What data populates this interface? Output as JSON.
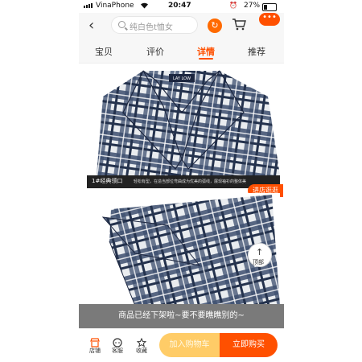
{
  "status_bar": {
    "carrier": "VinaPhone",
    "time": "20:47",
    "battery_percent": "27%",
    "battery_level": 0.27
  },
  "nav": {
    "search_placeholder": "纯白色t恤女",
    "more_label": "•••",
    "share_label": "↻"
  },
  "tabs": [
    {
      "label": "宝贝",
      "active": false
    },
    {
      "label": "评价",
      "active": false
    },
    {
      "label": "详情",
      "active": true
    },
    {
      "label": "推荐",
      "active": false
    }
  ],
  "detail": {
    "caption_title": "1#经典领口",
    "caption_desc": "轻松有型，在造当部位弯曲成为优美的弧线，展现袖衫的整体美",
    "brand_tag": "LAY LOW"
  },
  "floating": {
    "progress_tag": "进店逛逛",
    "top_label": "顶部"
  },
  "offshelf_notice": "商品已经下架啦~要不要瞧瞧别的~",
  "bottom_bar": {
    "shop_label": "店铺",
    "service_label": "客服",
    "favorite_label": "收藏",
    "add_to_cart_label": "加入购物车",
    "buy_now_label": "立即购买"
  },
  "colors": {
    "accent": "#ff5000",
    "cart_button": "#ffc44d",
    "plaid_navy": "#3d4f6e",
    "plaid_white": "#e9ecef"
  }
}
